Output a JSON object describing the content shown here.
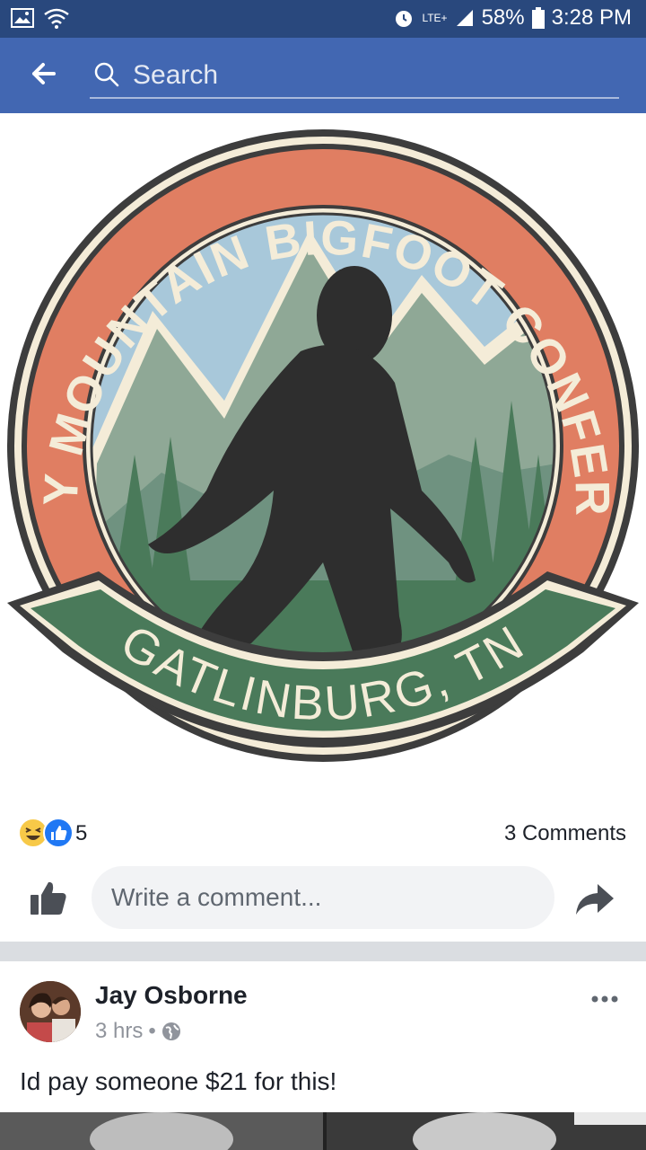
{
  "status_bar": {
    "battery": "58%",
    "time": "3:28 PM",
    "network": "LTE+"
  },
  "search": {
    "placeholder": "Search"
  },
  "logo": {
    "top_text": "SMOKY MOUNTAIN BIGFOOT CONFERENCE",
    "banner_text": "GATLINBURG, TN"
  },
  "reactions": {
    "count": "5",
    "comments": "3 Comments"
  },
  "comment_box": {
    "placeholder": "Write a comment..."
  },
  "comment": {
    "author": "Jay Osborne",
    "time": "3 hrs",
    "separator": "•",
    "text": "Id pay someone $21 for this!"
  },
  "colors": {
    "status_bar": "#29487d",
    "app_bar": "#4267b2",
    "ring_orange": "#e07e62",
    "banner_green": "#4a7a5a",
    "mountain_sage": "#8fa896",
    "sky_blue": "#a8c8da",
    "silhouette": "#2e2e2e"
  }
}
